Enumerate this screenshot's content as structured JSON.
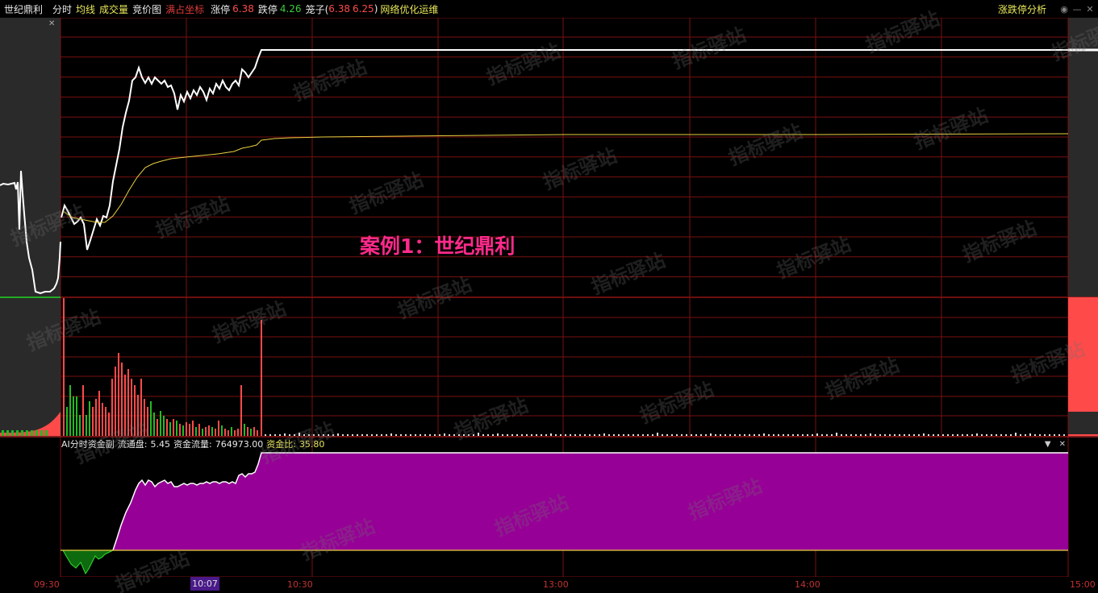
{
  "header": {
    "stock_name": "世纪鼎利",
    "tab_fenshi": "分时",
    "avg_line": "均线",
    "volume": "成交量",
    "auction": "竞价图",
    "fullscreen_coords": "满占坐标",
    "limit_up_label": "涨停",
    "limit_up_value": "6.38",
    "limit_down_label": "跌停",
    "limit_down_value": "4.26",
    "cage_label": "笼子(",
    "cage_v1": "6.38",
    "cage_v2": "6.25",
    "cage_close": ")",
    "network": "网络优化运维",
    "analysis": "涨跌停分析"
  },
  "subchart": {
    "title": "AI分时资金副",
    "float_label": "流通盘:",
    "float_value": "5.45",
    "flow_label": "资金流量:",
    "flow_value": "764973.00",
    "ratio_label": "资金比:",
    "ratio_value": "35.80"
  },
  "time_axis": {
    "t0930": "09:30",
    "t1030": "10:30",
    "t1300": "13:00",
    "t1400": "14:00",
    "t1500": "15:00",
    "cursor": "10:07"
  },
  "annotation": "案例1：世纪鼎利",
  "watermark": "指标驿站",
  "colors": {
    "grid": "#7a1010",
    "price_line": "#ffffff",
    "avg_line": "#e8d040",
    "vol_up": "#ff4a4a",
    "vol_down": "#22bb22",
    "fund_fill": "#960096",
    "fund_neg": "#0e6a0e",
    "annotation": "#ff2a8a"
  }
}
